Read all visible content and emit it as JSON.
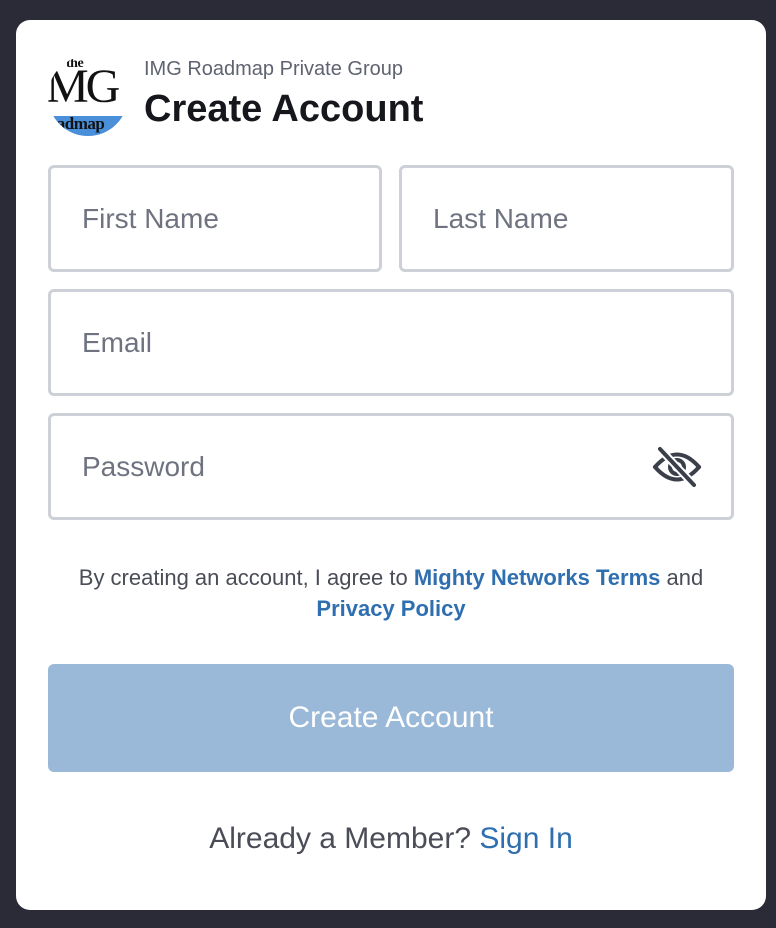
{
  "header": {
    "logo": {
      "top_text": "the",
      "main_text": "MG",
      "bottom_text": "roadmap",
      "band_color": "#4a8fd9"
    },
    "group_name": "IMG Roadmap Private Group",
    "title": "Create Account"
  },
  "form": {
    "first_name": {
      "placeholder": "First Name",
      "value": ""
    },
    "last_name": {
      "placeholder": "Last Name",
      "value": ""
    },
    "email": {
      "placeholder": "Email",
      "value": ""
    },
    "password": {
      "placeholder": "Password",
      "value": "",
      "toggle_icon": "eye-off-icon"
    }
  },
  "terms": {
    "prefix": "By creating an account, I agree to ",
    "terms_link": "Mighty Networks Terms",
    "conjunction": " and ",
    "privacy_link": "Privacy Policy"
  },
  "submit_label": "Create Account",
  "signin": {
    "prompt": "Already a Member? ",
    "link": "Sign In"
  },
  "colors": {
    "background": "#2a2b36",
    "link": "#2f6fb0",
    "button_disabled": "#9ab9d8",
    "field_border": "#cdd0d6"
  }
}
